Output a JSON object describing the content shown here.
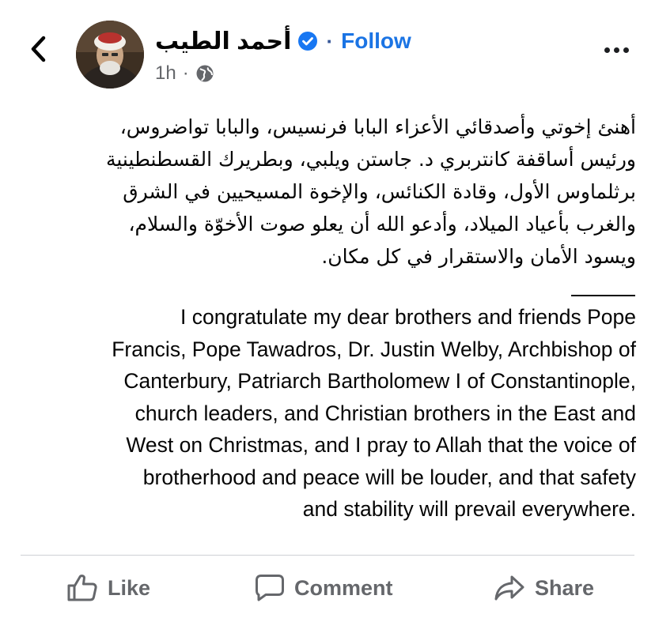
{
  "header": {
    "author_name": "أحمد الطيب",
    "separator": "·",
    "follow_label": "Follow",
    "timestamp": "1h",
    "meta_separator": "·",
    "audience_icon": "globe-icon",
    "verified_icon": "verified-badge-icon",
    "back_icon": "chevron-left-icon",
    "more_icon": "more-horizontal-icon"
  },
  "post": {
    "arabic_lines": [
      "أهنئ إخوتي وأصدقائي الأعزاء البابا فرنسيس، والبابا تواضروس،",
      "ورئيس أساقفة كانتربري د. جاستن ويلبي، وبطريرك القسطنطينية",
      "برثلماوس الأول، وقادة الكنائس، والإخوة المسيحيين في الشرق",
      "والغرب بأعياد الميلاد، وأدعو الله أن يعلو صوت الأخوّة والسلام،",
      "ويسود الأمان والاستقرار في كل مكان."
    ],
    "english_lines": [
      "I congratulate my dear brothers and friends Pope",
      "Francis, Pope Tawadros, Dr. Justin Welby, Archbishop of",
      "Canterbury, Patriarch Bartholomew I of Constantinople,",
      "church leaders, and Christian brothers in the East and",
      "West on Christmas, and I pray to Allah that the voice of",
      "brotherhood and peace will be louder, and that safety",
      "and stability will prevail everywhere."
    ]
  },
  "actions": {
    "like_label": "Like",
    "comment_label": "Comment",
    "share_label": "Share",
    "like_icon": "thumbs-up-icon",
    "comment_icon": "comment-bubble-icon",
    "share_icon": "share-arrow-icon"
  },
  "colors": {
    "link_blue": "#1b74e4",
    "verified_blue": "#1877f2",
    "muted_text": "#65676b",
    "main_text": "#050505",
    "divider": "#ced0d4"
  }
}
